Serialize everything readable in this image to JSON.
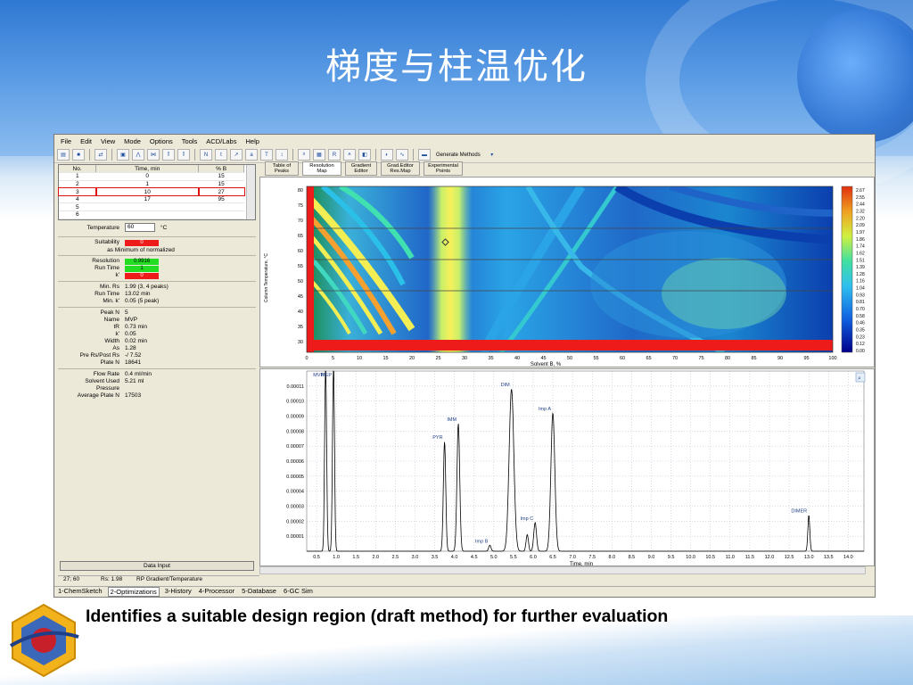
{
  "slide": {
    "title": "梯度与柱温优化",
    "caption": "Identifies a suitable design region (draft method) for further evaluation"
  },
  "menu": [
    "File",
    "Edit",
    "View",
    "Mode",
    "Options",
    "Tools",
    "ACD/Labs",
    "Help"
  ],
  "toolbar": {
    "generate_label": "Generate Methods"
  },
  "gradient_table": {
    "headers": [
      "No.",
      "Time, min",
      "% B"
    ],
    "rows": [
      [
        "1",
        "0",
        "15"
      ],
      [
        "2",
        "1",
        "15"
      ],
      [
        "3",
        "10",
        "27"
      ],
      [
        "4",
        "17",
        "95"
      ],
      [
        "5",
        "",
        ""
      ],
      [
        "6",
        "",
        ""
      ]
    ]
  },
  "params": {
    "temperature_label": "Temperature",
    "temperature_value": "60",
    "temperature_unit": "°C",
    "suitability_label": "Suitability",
    "suitability_value": "0",
    "as_minimum_label": "as Minimum of normalized",
    "resolution_label": "Resolution",
    "resolution_value": "0.9916",
    "runtime_label": "Run Time",
    "runtime_value": "1",
    "k_label": "k'",
    "k_value": "0",
    "min_rs_label": "Min. Rs",
    "min_rs_value": "1.99 (3, 4 peaks)",
    "run_time_label": "Run Time",
    "run_time_value": "13.02 min",
    "min_k_label": "Min. k'",
    "min_k_value": "0.05 (5 peak)",
    "peak_n_label": "Peak N",
    "peak_n_value": "5",
    "name_label": "Name",
    "name_value": "MVP",
    "tr_label": "tR",
    "tr_value": "0.73 min",
    "kprime_label": "k'",
    "kprime_value": "0.05",
    "width_label": "Width",
    "width_value": "0.02 min",
    "as_label": "As",
    "as_value": "1.28",
    "prepost_label": "Pre Rs/Post Rs",
    "prepost_value": "-/ 7.52",
    "plate_label": "Plate N",
    "plate_value": "18641",
    "flow_label": "Flow Rate",
    "flow_value": "0.4 ml/min",
    "solvent_label": "Solvent Used",
    "solvent_value": "5.21 ml",
    "pressure_label": "Pressure",
    "pressure_value": "",
    "avg_plate_label": "Average Plate N",
    "avg_plate_value": "17503",
    "data_input_label": "Data Input",
    "status_coords": "27; 60",
    "status_rs": "Rs: 1.98",
    "status_mode": "RP Gradient/Temperature"
  },
  "tabs": [
    "Table of Peaks",
    "Resolution Map",
    "Gradient Editor",
    "Grad.Editor Res.Map",
    "Experimental Points"
  ],
  "bottom_tabs": [
    "1-ChemSketch",
    "2-Optimizations",
    "3-History",
    "4-Processor",
    "5-Database",
    "6-GC Sim"
  ],
  "colors": {
    "accent": "#2f78d3",
    "red": "#ee1b1b",
    "green": "#22dd22"
  },
  "resmap": {
    "xlabel": "Solvent B, %",
    "ylabel": "Column Temperature, °C",
    "x_ticks": [
      "0",
      "5",
      "10",
      "15",
      "20",
      "25",
      "30",
      "35",
      "40",
      "45",
      "50",
      "55",
      "60",
      "65",
      "70",
      "75",
      "80",
      "85",
      "90",
      "95",
      "100"
    ],
    "y_ticks": [
      "30",
      "35",
      "40",
      "45",
      "50",
      "55",
      "60",
      "65",
      "70",
      "75",
      "80"
    ],
    "scale": [
      "2.67",
      "2.55",
      "2.44",
      "2.32",
      "2.20",
      "2.09",
      "1.97",
      "1.86",
      "1.74",
      "1.62",
      "1.51",
      "1.39",
      "1.28",
      "1.16",
      "1.04",
      "0.93",
      "0.81",
      "0.70",
      "0.58",
      "0.46",
      "0.35",
      "0.23",
      "0.12",
      "0.00"
    ]
  },
  "chart_data": {
    "type": "line",
    "title": "",
    "xlabel": "Time, min",
    "ylabel": "",
    "xlim": [
      0.25,
      14.4
    ],
    "ylim": [
      0,
      0.00012
    ],
    "x_ticks": [
      "0.5",
      "1.0",
      "1.5",
      "2.0",
      "2.5",
      "3.0",
      "3.5",
      "4.0",
      "4.5",
      "5.0",
      "5.5",
      "6.0",
      "6.5",
      "7.0",
      "7.5",
      "8.0",
      "8.5",
      "9.0",
      "9.5",
      "10.0",
      "10.5",
      "11.0",
      "11.5",
      "12.0",
      "12.5",
      "13.0",
      "13.5",
      "14.0"
    ],
    "y_ticks": [
      "0.00001",
      "0.00002",
      "0.00003",
      "0.00004",
      "0.00005",
      "0.00006",
      "0.00007",
      "0.00008",
      "0.00009",
      "0.00010",
      "0.00011"
    ],
    "peaks": [
      {
        "name": "MVP",
        "x": 0.73,
        "height": 0.000125,
        "width": 0.025
      },
      {
        "name": "MEP",
        "x": 0.93,
        "height": 0.000125,
        "width": 0.025
      },
      {
        "name": "PYR",
        "x": 3.75,
        "height": 7.3e-05,
        "width": 0.03
      },
      {
        "name": "IMM",
        "x": 4.1,
        "height": 8.5e-05,
        "width": 0.035
      },
      {
        "name": "Imp B",
        "x": 4.9,
        "height": 4e-06,
        "width": 0.03
      },
      {
        "name": "DIM",
        "x": 5.45,
        "height": 0.000108,
        "width": 0.06
      },
      {
        "name": "",
        "x": 5.85,
        "height": 1.1e-05,
        "width": 0.03
      },
      {
        "name": "Imp C",
        "x": 6.05,
        "height": 1.9e-05,
        "width": 0.035
      },
      {
        "name": "Imp A",
        "x": 6.5,
        "height": 9.2e-05,
        "width": 0.05
      },
      {
        "name": "DIMER",
        "x": 13.0,
        "height": 2.4e-05,
        "width": 0.025
      }
    ]
  }
}
